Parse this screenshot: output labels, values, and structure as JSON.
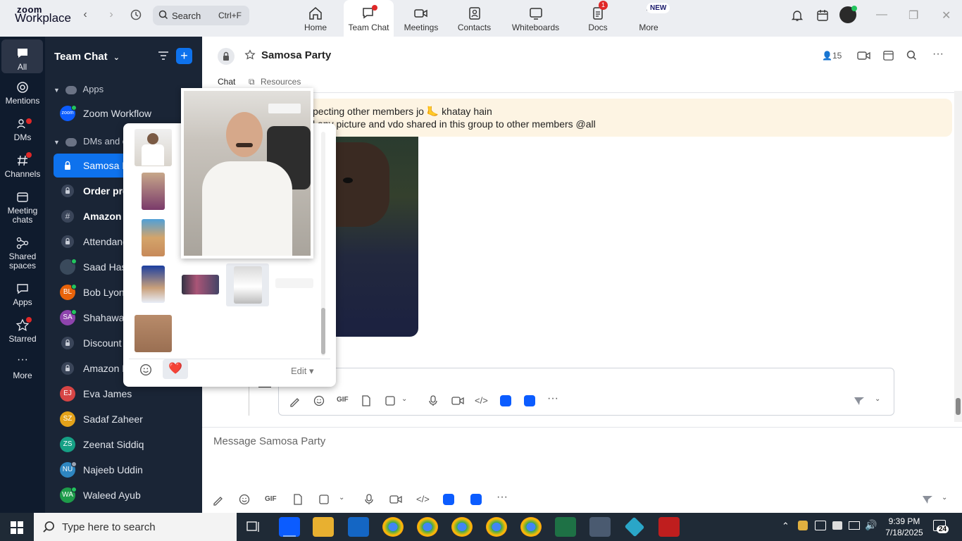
{
  "app": {
    "logo_top": "zoom",
    "logo_bottom": "Workplace"
  },
  "search": {
    "label": "Search",
    "shortcut": "Ctrl+F"
  },
  "tabs": [
    {
      "label": "Home"
    },
    {
      "label": "Team Chat"
    },
    {
      "label": "Meetings"
    },
    {
      "label": "Contacts"
    },
    {
      "label": "Whiteboards"
    },
    {
      "label": "Docs",
      "badge": "1"
    },
    {
      "label": "More",
      "badge": "NEW"
    }
  ],
  "rail": [
    {
      "label": "All"
    },
    {
      "label": "Mentions"
    },
    {
      "label": "DMs"
    },
    {
      "label": "Channels"
    },
    {
      "label": "Meeting chats"
    },
    {
      "label": "Shared spaces"
    },
    {
      "label": "Apps"
    },
    {
      "label": "Starred"
    },
    {
      "label": "More"
    }
  ],
  "sidebar": {
    "title": "Team Chat",
    "section_apps": "Apps",
    "section_dms": "DMs and ch",
    "items": [
      {
        "name": "Zoom Workflow",
        "initials": "zoom",
        "color": "#0b5cff"
      },
      {
        "name": "Samosa P",
        "type": "lock"
      },
      {
        "name": "Order pro",
        "type": "lock"
      },
      {
        "name": "Amazon",
        "type": "hash"
      },
      {
        "name": "Attendanc",
        "type": "lock"
      },
      {
        "name": "Saad Has",
        "initials": "",
        "color": "#3a4a5c"
      },
      {
        "name": "Bob Lyon",
        "initials": "BL",
        "color": "#e8630a"
      },
      {
        "name": "Shahawal",
        "initials": "SA",
        "color": "#8e44ad"
      },
      {
        "name": "Discount",
        "type": "lock"
      },
      {
        "name": "Amazon P",
        "type": "lock"
      },
      {
        "name": "Eva James",
        "initials": "EJ",
        "color": "#d64545"
      },
      {
        "name": "Sadaf Zaheer",
        "initials": "SZ",
        "color": "#e3a21a"
      },
      {
        "name": "Zeenat Siddiq",
        "initials": "ZS",
        "color": "#16a085"
      },
      {
        "name": "Najeeb Uddin",
        "initials": "NU",
        "color": "#2e86c1"
      },
      {
        "name": "Waleed Ayub",
        "initials": "WA",
        "color": "#1e9c4a"
      }
    ]
  },
  "channel": {
    "title": "Samosa Party",
    "member_count": "15",
    "tab_chat": "Chat",
    "tab_resources": "Resources",
    "pinned_line1": "pecting other members jo 🦶 khatay hain",
    "pinned_line2": "l any picture and vdo shared in this group to other members @all",
    "composer_placeholder": "Message Samosa Party"
  },
  "popup": {
    "edit_label": "Edit ▾",
    "reaction": "❤️"
  },
  "taskbar": {
    "search_placeholder": "Type here to search",
    "time": "9:39 PM",
    "date": "7/18/2025",
    "notif_count": "24"
  }
}
